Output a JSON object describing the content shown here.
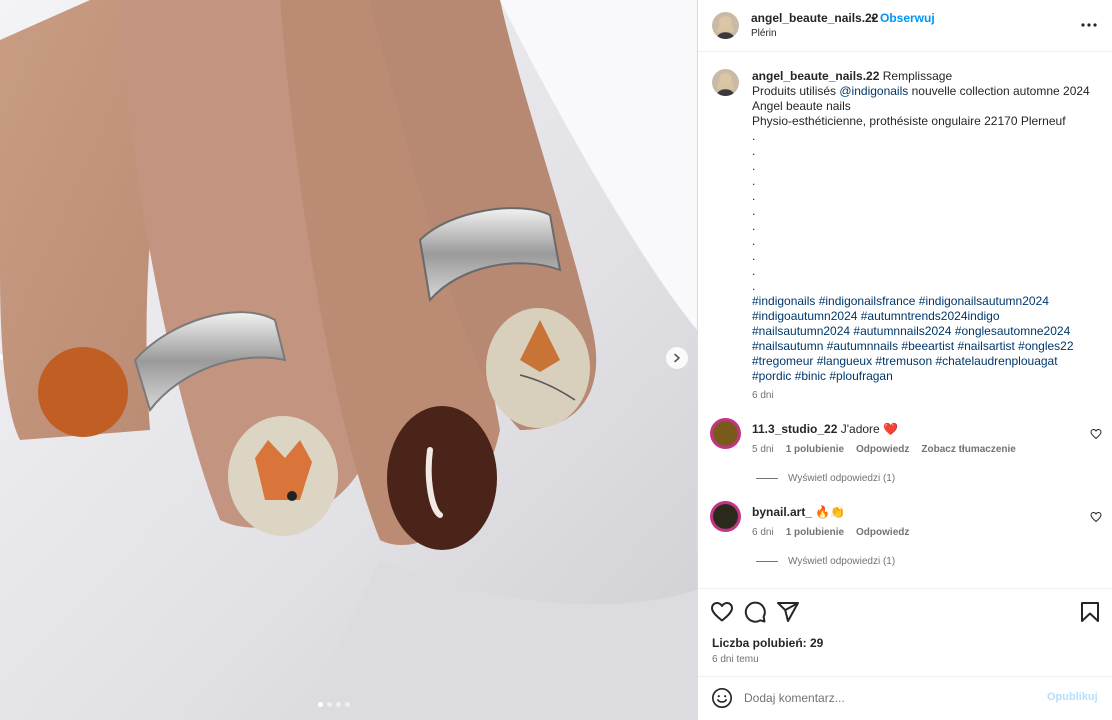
{
  "post": {
    "username": "angel_beaute_nails.22",
    "separator": "•",
    "follow_label": "Obserwuj",
    "location": "Plérin"
  },
  "caption": {
    "username": "angel_beaute_nails.22",
    "title": "Remplissage",
    "line1_prefix": "Produits utilisés ",
    "line1_mention": "@indigonails",
    "line1_suffix": " nouvelle collection automne 2024",
    "line2": "Angel beaute nails",
    "line3": "Physio-esthéticienne, prothésiste ongulaire 22170 Plerneuf",
    "dots": [
      ".",
      ".",
      ".",
      ".",
      ".",
      ".",
      ".",
      ".",
      ".",
      ".",
      "."
    ],
    "hashtag_lines": [
      "#indigonails #indigonailsfrance #indigonailsautumn2024",
      "#indigoautumn2024 #autumntrends2024indigo",
      "#nailsautumn2024 #autumnnails2024 #onglesautomne2024",
      "#nailsautumn #autumnnails #beeartist #nailsartist #ongles22",
      "#tregomeur #langueux #tremuson #chatelaudrenplouagat",
      "#pordic #binic #ploufragan"
    ],
    "time": "6 dni"
  },
  "comments": [
    {
      "username": "11.3_studio_22",
      "text": "J'adore",
      "emoji": "❤️",
      "time": "5 dni",
      "likes": "1 polubienie",
      "reply": "Odpowiedz",
      "translate": "Zobacz tłumaczenie",
      "view_replies": "Wyświetl odpowiedzi (1)"
    },
    {
      "username": "bynail.art_",
      "text": "",
      "emoji": "🔥👏",
      "time": "6 dni",
      "likes": "1 polubienie",
      "reply": "Odpowiedz",
      "view_replies": "Wyświetl odpowiedzi (1)"
    }
  ],
  "footer": {
    "likes": "Liczba polubień: 29",
    "date": "6 dni temu",
    "comment_placeholder": "Dodaj komentarz...",
    "post_label": "Opublikuj"
  },
  "icons": {
    "like": "heart-icon",
    "comment": "comment-icon",
    "share": "share-icon",
    "save": "bookmark-icon",
    "more": "more-icon",
    "emoji": "emoji-icon",
    "next": "chevron-right-icon"
  },
  "colors": {
    "accent": "#0095f6",
    "link": "#00376b",
    "muted": "#737373",
    "heart": "#ed4956"
  },
  "carousel": {
    "slides": 4,
    "active": 1
  }
}
